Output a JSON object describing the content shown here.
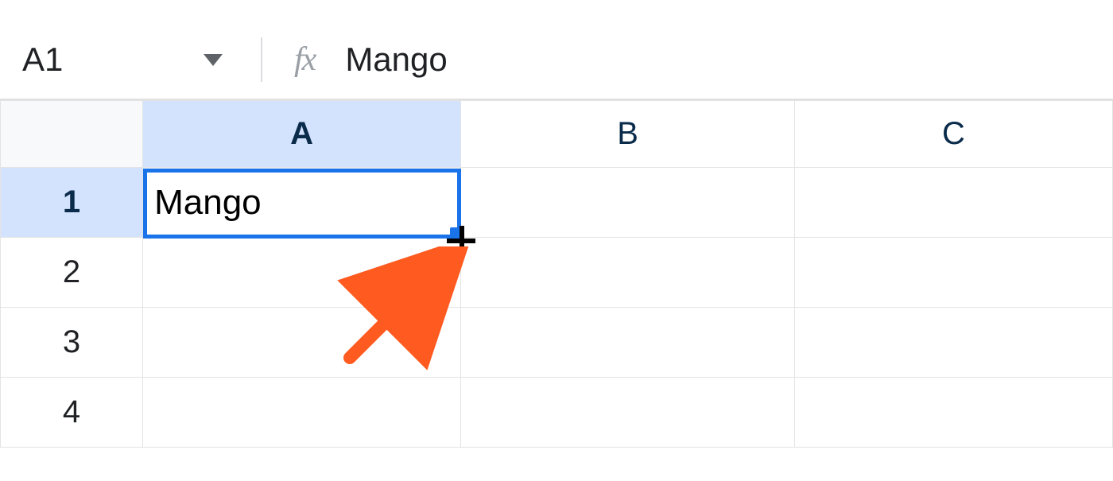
{
  "name_box": {
    "value": "A1"
  },
  "formula_bar": {
    "fx_label": "fx",
    "value": "Mango"
  },
  "columns": [
    {
      "label": "A",
      "active": true
    },
    {
      "label": "B",
      "active": false
    },
    {
      "label": "C",
      "active": false
    }
  ],
  "rows": [
    {
      "label": "1",
      "active": true
    },
    {
      "label": "2",
      "active": false
    },
    {
      "label": "3",
      "active": false
    },
    {
      "label": "4",
      "active": false
    }
  ],
  "cells": {
    "A1": "Mango",
    "B1": "",
    "C1": "",
    "A2": "",
    "B2": "",
    "C2": "",
    "A3": "",
    "B3": "",
    "C3": "",
    "A4": "",
    "B4": "",
    "C4": ""
  },
  "selection": {
    "ref": "A1"
  },
  "annotation": {
    "type": "arrow",
    "color": "#ff5a1f",
    "points_to": "fill-handle"
  }
}
